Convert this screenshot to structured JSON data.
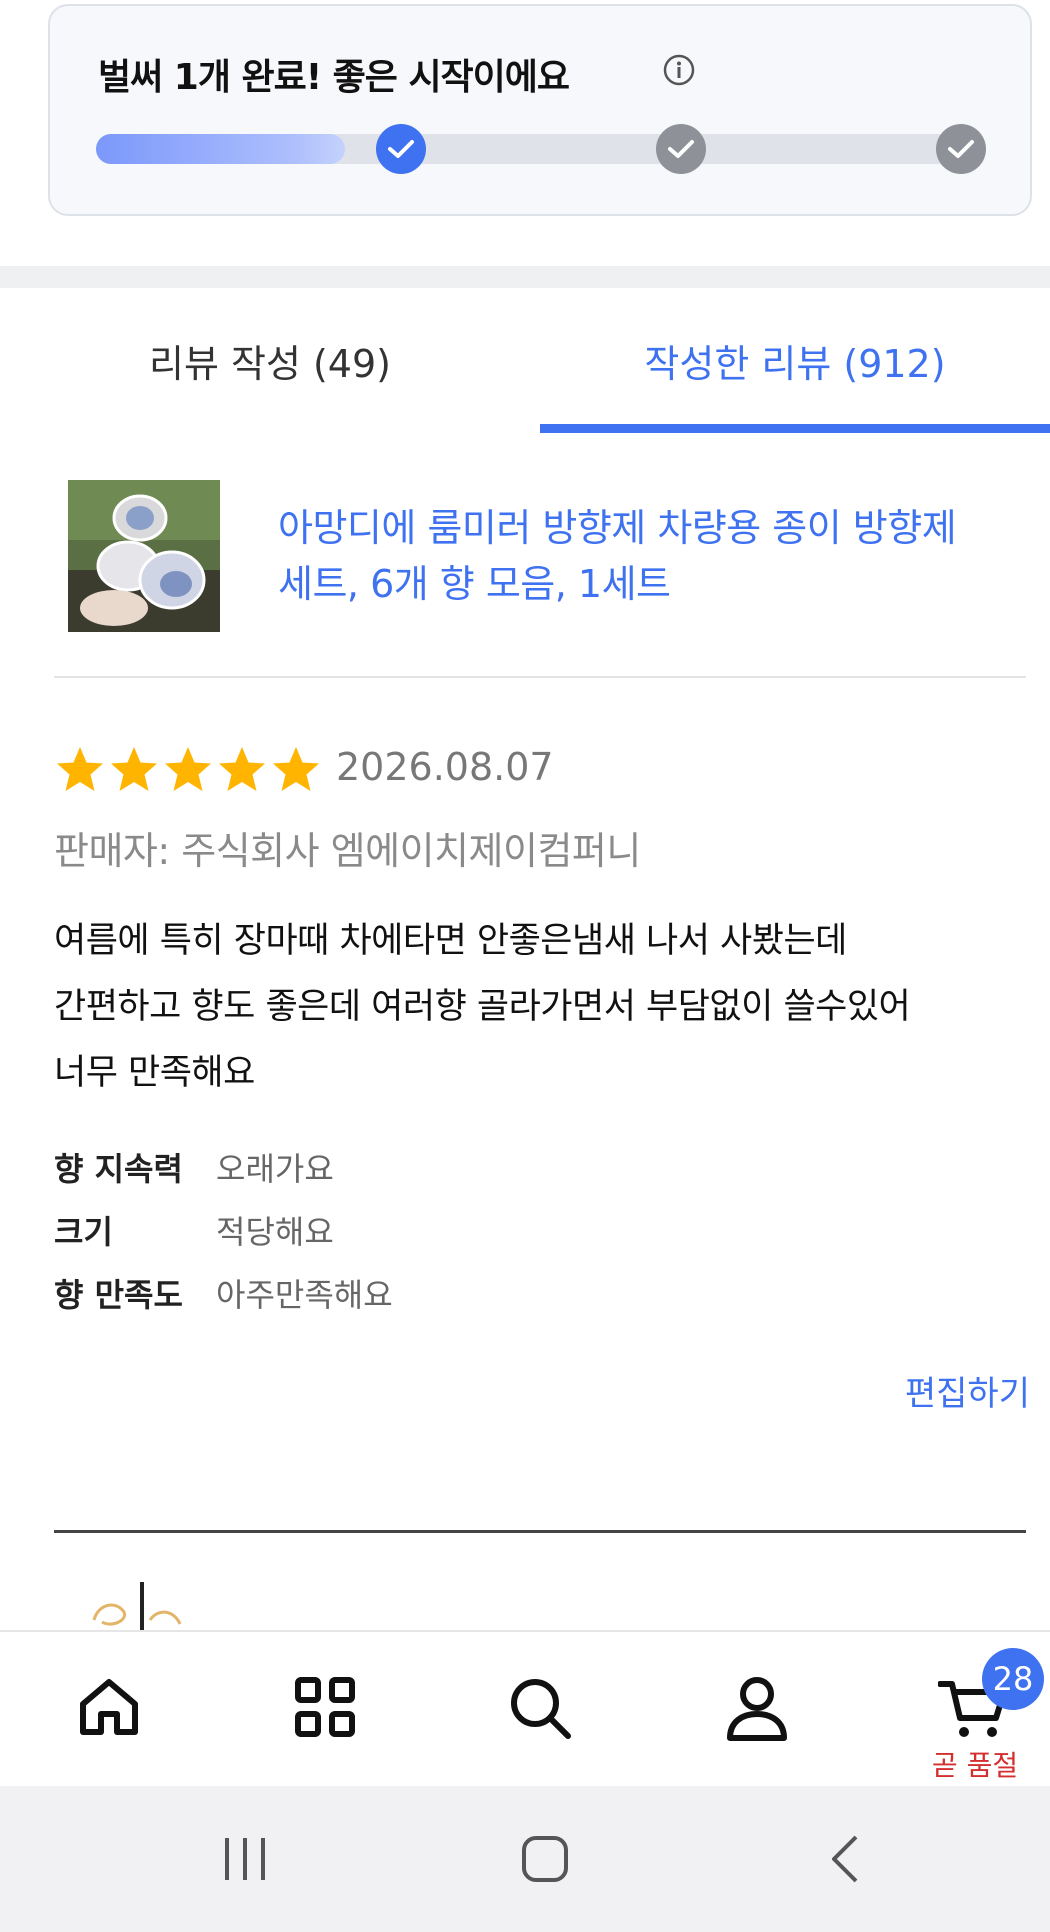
{
  "progress": {
    "title": "벌써 1개 완료! 좋은 시작이에요",
    "completed_fraction": 0.28,
    "steps": [
      {
        "state": "done"
      },
      {
        "state": "todo"
      },
      {
        "state": "todo"
      }
    ],
    "accent_color": "#3f72f0"
  },
  "tabs": [
    {
      "label": "리뷰 작성 (49)",
      "active": false
    },
    {
      "label": "작성한 리뷰 (912)",
      "active": true
    }
  ],
  "product": {
    "name": "아망디에 룸미러 방향제 차량용 종이 방향제 세트, 6개 향 모음, 1세트"
  },
  "review": {
    "rating": 5,
    "date": "2026.08.07",
    "seller": "판매자: 주식회사 엠에이치제이컴퍼니",
    "text_lines": [
      "여름에 특히 장마때 차에타면 안좋은냄새 나서 사봤는데",
      "간편하고 향도 좋은데 여러향 골라가면서 부담없이 쓸수있어",
      "너무 만족해요"
    ],
    "attributes": [
      {
        "key": "향 지속력",
        "value": "오래가요"
      },
      {
        "key": "크기",
        "value": "적당해요"
      },
      {
        "key": "향 만족도",
        "value": "아주만족해요"
      }
    ],
    "edit_label": "편집하기"
  },
  "bottom_nav": {
    "items": [
      {
        "icon": "home-icon"
      },
      {
        "icon": "category-grid-icon"
      },
      {
        "icon": "search-icon"
      },
      {
        "icon": "user-icon"
      },
      {
        "icon": "cart-icon"
      }
    ],
    "cart_badge": "28",
    "cart_note": "곧 품절"
  },
  "system_nav": {
    "icons": [
      "recent-apps-icon",
      "home-button-icon",
      "back-icon"
    ]
  }
}
